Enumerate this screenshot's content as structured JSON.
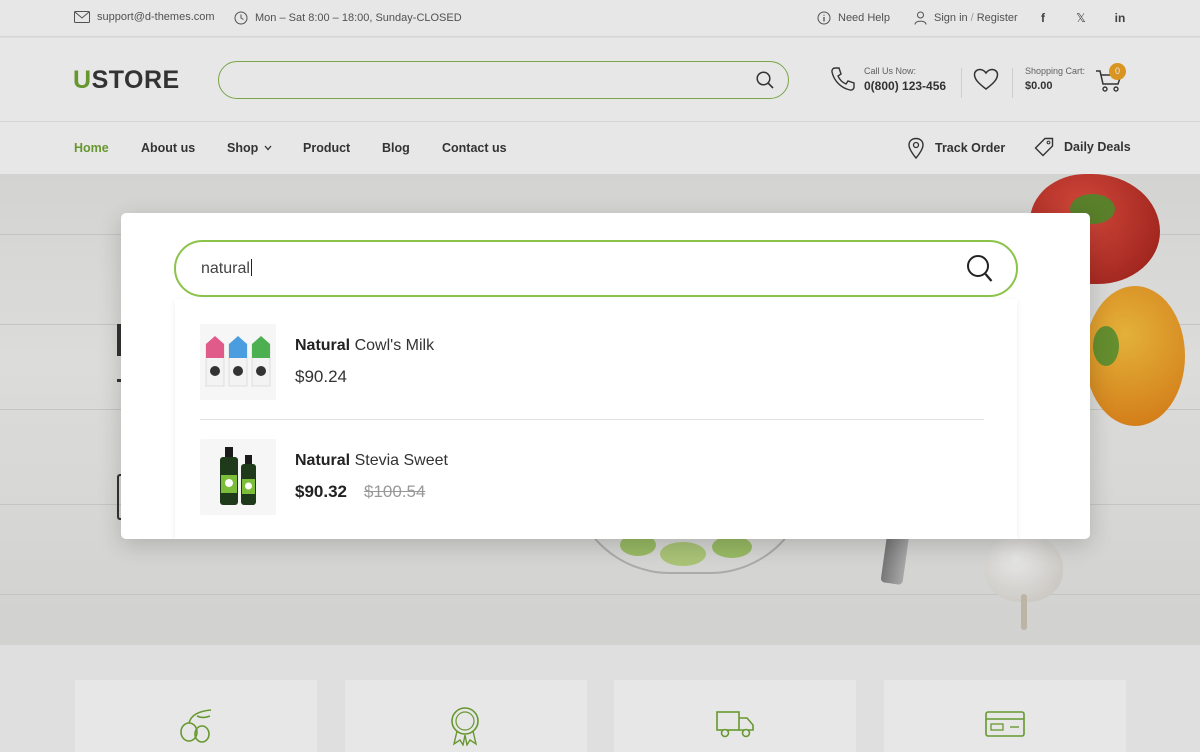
{
  "topbar": {
    "email": "support@d-themes.com",
    "hours": "Mon – Sat 8:00 – 18:00, Sunday-CLOSED",
    "help": "Need Help",
    "signin": "Sign in",
    "separator": "/",
    "register": "Register",
    "social": [
      "f",
      "𝕏",
      "in"
    ]
  },
  "header": {
    "logo_first": "U",
    "logo_rest": "STORE",
    "call_label": "Call Us Now:",
    "call_number": "0(800) 123-456",
    "cart_label": "Shopping Cart:",
    "cart_total": "$0.00",
    "cart_count": "0"
  },
  "nav": {
    "items": [
      {
        "label": "Home",
        "active": true
      },
      {
        "label": "About us"
      },
      {
        "label": "Shop"
      },
      {
        "label": "Product"
      },
      {
        "label": "Blog"
      },
      {
        "label": "Contact us"
      }
    ],
    "track_order": "Track Order",
    "daily_deals": "Daily Deals"
  },
  "search_modal": {
    "query": "natural",
    "results": [
      {
        "match": "Natural",
        "rest": " Cowl's Milk",
        "price": "$90.24"
      },
      {
        "match": "Natural",
        "rest": " Stevia Sweet",
        "price": "$90.32",
        "old_price": "$100.54"
      }
    ]
  },
  "features": {
    "icons": [
      "olive-icon",
      "best-badge-icon",
      "delivery-truck-icon",
      "payment-card-icon"
    ]
  },
  "colors": {
    "accent": "#6ea52f",
    "badge": "#f0a21c"
  }
}
